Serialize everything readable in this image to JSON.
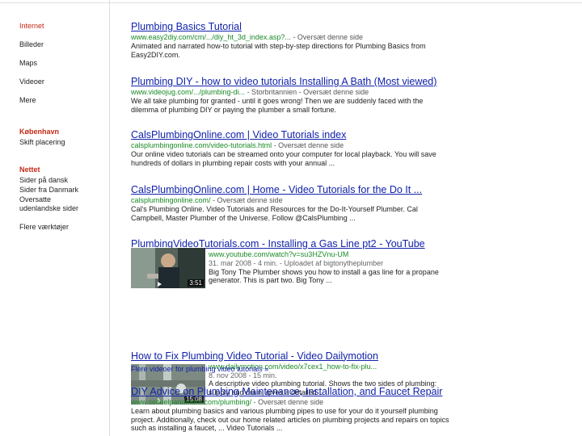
{
  "sidebar": {
    "items": [
      {
        "label": "Internet"
      },
      {
        "label": "Billeder"
      },
      {
        "label": "Maps"
      },
      {
        "label": "Videoer"
      },
      {
        "label": "Mere"
      }
    ],
    "location": {
      "heading": "København",
      "change": "Skift placering"
    },
    "tools": {
      "heading": "Nettet",
      "items": [
        "Sider på dansk",
        "Sider fra Danmark",
        "Oversatte udenlandske sider"
      ],
      "more": "Flere værktøjer"
    }
  },
  "results": [
    {
      "title": "Plumbing Basics Tutorial",
      "url": "www.easy2diy.com/cm/.../diy_ht_3d_index.asp?... ",
      "translate": "- Oversæt denne side",
      "snippet": "Animated and narrated how-to tutorial with step-by-step directions for Plumbing Basics from Easy2DIY.com."
    },
    {
      "title": "Plumbing DIY - how to video tutorials Installing A Bath (Most viewed)",
      "url": "www.videojug.com/.../plumbing-di... ",
      "translate": "- Storbritannien - Oversæt denne side",
      "snippet": "We all take plumbing for granted - until it goes wrong! Then we are suddenly faced with the dilemma of plumbing DIY or paying the plumber a small fortune."
    },
    {
      "title": "CalsPlumbingOnline.com | Video Tutorials index",
      "url": "calsplumbingonline.com/video-tutorials.html ",
      "translate": "- Oversæt denne side",
      "snippet": "Our online video tutorials can be streamed onto your computer for local playback. You will save hundreds of dollars in plumbing repair costs with your annual ..."
    },
    {
      "title": "CalsPlumbingOnline.com | Home - Video Tutorials for the Do It ...",
      "url": "calsplumbingonline.com/ ",
      "translate": "- Oversæt denne side",
      "snippet": "Cal's Plumbing Online. Video Tutorials and Resources for the Do-It-Yourself Plumber. Cal Campbell, Master Plumber of the Universe. Follow @CalsPlumbing ..."
    },
    {
      "title": "PlumbingVideoTutorials.com - Installing a Gas Line pt2 - YouTube",
      "url": "www.youtube.com/watch?v=su3HZVnu-UM",
      "meta": "31. mar 2008 - 4 min. - Uploadet af bigtonytheplumber",
      "snippet": "Big Tony The Plumber shows you how to install a gas line for a propane generator. This is part two. Big Tony ...",
      "duration": "3:51"
    },
    {
      "title": "How to Fix Plumbing Video Tutorial - Video Dailymotion",
      "url": "www.dailymotion.com/video/x7cex1_how-to-fix-plu...",
      "meta": "8. nov 2008 - 15 min.",
      "snippet": "A descriptive video plumbing tutorial. Shows the two sides of plumbing: supply and drain, gives a detailed ...",
      "duration": "15:08"
    },
    {
      "more_videos": "Flere videoer for plumbing video tutorials »"
    },
    {
      "title": "DIY Advice on Plumbing Maintenance, Installation, and Faucet Repair",
      "url": "www.selfhelpandmore.com/plumbing/ ",
      "translate": "- Oversæt denne side",
      "snippet": "Learn about plumbing basics and various plumbing pipes to use for your do it yourself plumbing project. Additionally, check out our home related articles on plumbing projects and repairs on topics such as installing a faucet, ... Video Tutorials ..."
    }
  ],
  "colors": {
    "link": "#1122aa",
    "url": "#1a8a26",
    "accent_red": "#c42a17"
  }
}
